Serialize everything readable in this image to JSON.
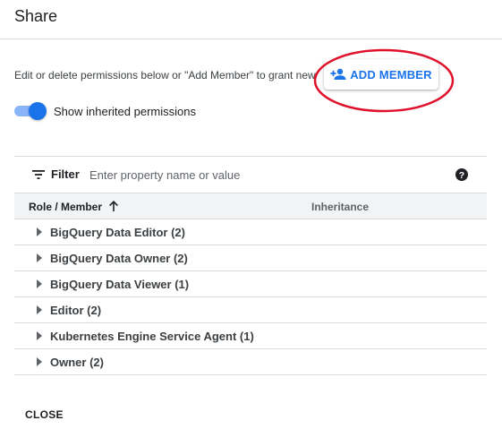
{
  "dialog": {
    "title": "Share"
  },
  "description": "Edit or delete permissions below or \"Add Member\" to grant new",
  "add_member": {
    "label": "ADD MEMBER",
    "icon": "person-add-icon",
    "color": "#1a73e8"
  },
  "highlight_color": "#e0112b",
  "inherited_toggle": {
    "label": "Show inherited permissions",
    "on": true
  },
  "filter": {
    "label": "Filter",
    "placeholder": "Enter property name or value",
    "value": ""
  },
  "table": {
    "columns": [
      "Role / Member",
      "Inheritance"
    ],
    "sort": "ascending",
    "rows": [
      {
        "label": "BigQuery Data Editor (2)"
      },
      {
        "label": "BigQuery Data Owner (2)"
      },
      {
        "label": "BigQuery Data Viewer (1)"
      },
      {
        "label": "Editor (2)"
      },
      {
        "label": "Kubernetes Engine Service Agent (1)"
      },
      {
        "label": "Owner (2)"
      }
    ]
  },
  "footer": {
    "close_label": "CLOSE"
  }
}
